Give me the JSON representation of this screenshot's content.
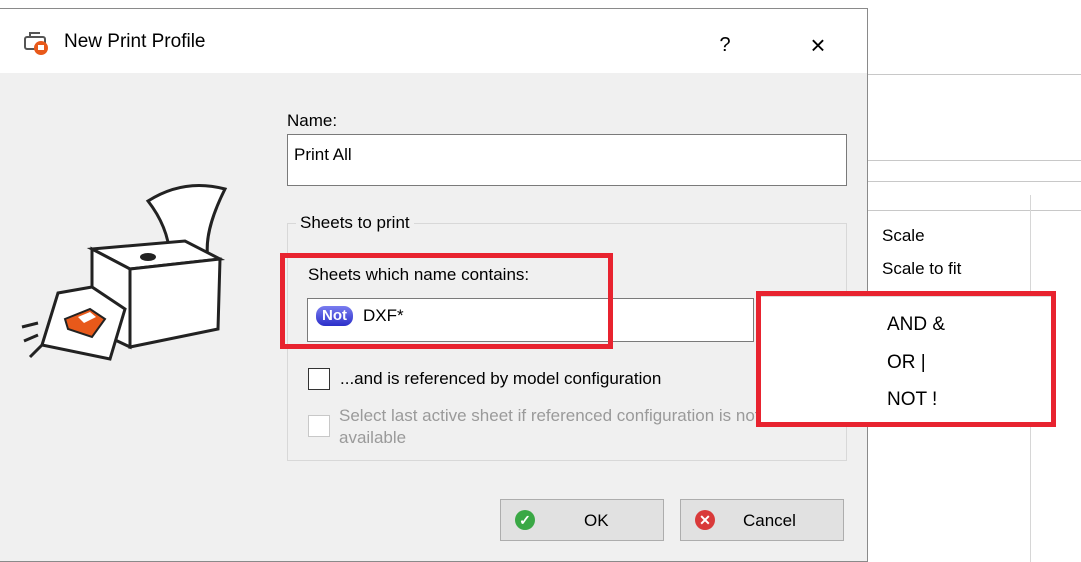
{
  "dialog": {
    "title": "New Print Profile",
    "help_label": "?",
    "close_label": "×"
  },
  "form": {
    "name_label": "Name:",
    "name_value": "Print All",
    "group_title": "Sheets to print",
    "contains_label": "Sheets which name contains:",
    "filter_chip": "Not",
    "filter_value": "DXF*",
    "insert_button": ">",
    "referenced_checkbox": {
      "label": "...and is referenced by model configuration",
      "checked": false
    },
    "last_active_checkbox": {
      "label": "Select last active sheet if referenced configuration is not available",
      "checked": false,
      "enabled": false
    }
  },
  "buttons": {
    "ok": "OK",
    "cancel": "Cancel"
  },
  "operator_menu": {
    "items": [
      "AND &",
      "OR |",
      "NOT !"
    ]
  },
  "background_panel": {
    "items": [
      "Scale",
      "Scale to fit"
    ]
  },
  "colors": {
    "annotation": "#e8232f",
    "ok_icon": "#3aa845",
    "cancel_icon": "#d93a3a",
    "chip": "#2b2fc9",
    "printer_accent": "#e8591a"
  }
}
